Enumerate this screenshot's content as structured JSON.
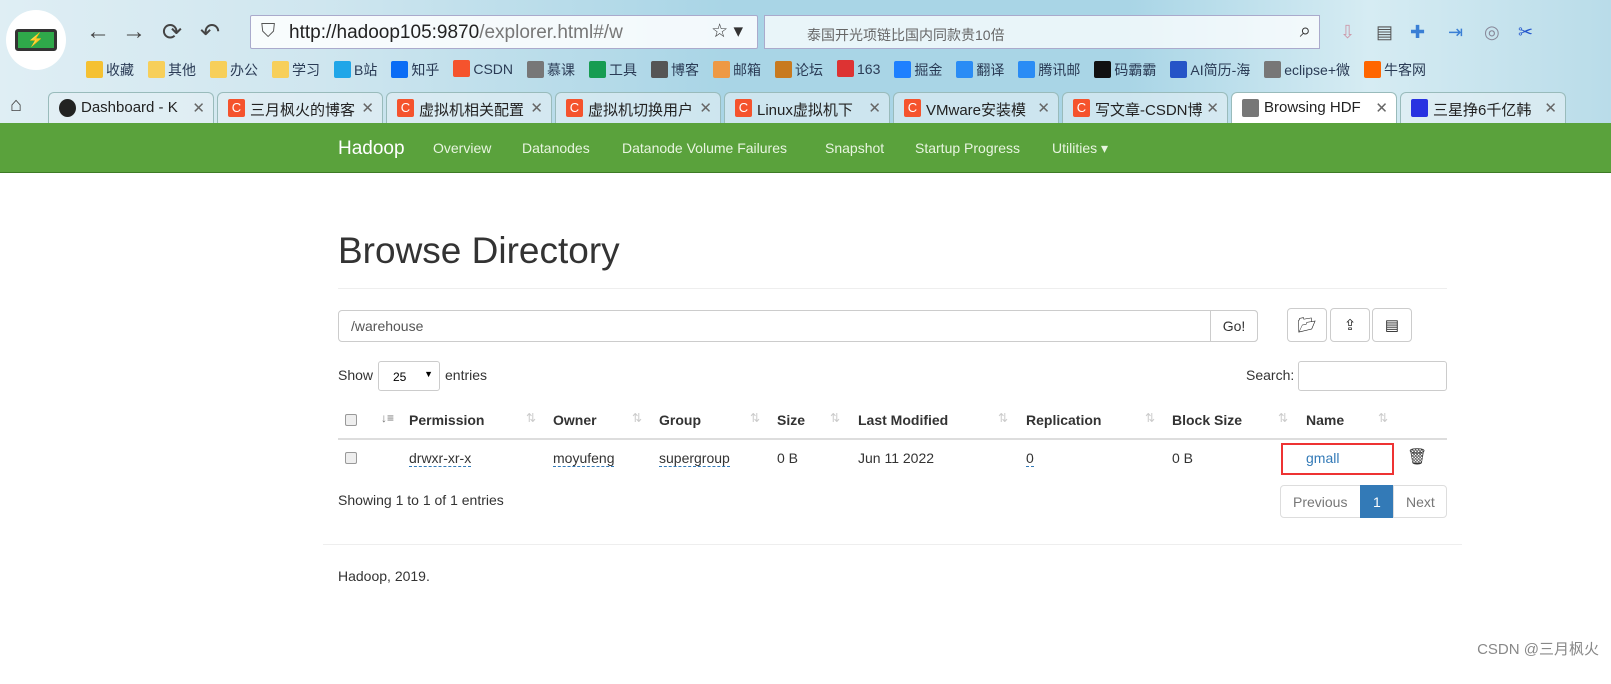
{
  "browser": {
    "url_host": "http://hadoop105:9870",
    "url_path": "/explorer.html#/w",
    "search_placeholder": "泰国开光项链比国内同款贵10倍",
    "bookmarks": [
      {
        "label": "收藏",
        "color": "#f5c132"
      },
      {
        "label": "其他",
        "color": "#f7cf5a"
      },
      {
        "label": "办公",
        "color": "#f7cf5a"
      },
      {
        "label": "学习",
        "color": "#f7cf5a"
      },
      {
        "label": "B站",
        "color": "#20a6e8"
      },
      {
        "label": "知乎",
        "color": "#0a6cf5"
      },
      {
        "label": "CSDN",
        "color": "#f5532d"
      },
      {
        "label": "慕课",
        "color": "#777"
      },
      {
        "label": "工具",
        "color": "#179c52"
      },
      {
        "label": "博客",
        "color": "#555"
      },
      {
        "label": "邮箱",
        "color": "#e94"
      },
      {
        "label": "论坛",
        "color": "#c87a1f"
      },
      {
        "label": "163",
        "color": "#d33"
      },
      {
        "label": "掘金",
        "color": "#1e80ff"
      },
      {
        "label": "翻译",
        "color": "#2a8cf5"
      },
      {
        "label": "腾讯邮",
        "color": "#2a8cf5"
      },
      {
        "label": "码霸霸",
        "color": "#111"
      },
      {
        "label": "AI简历-海",
        "color": "#2554c7"
      },
      {
        "label": "eclipse+微",
        "color": "#777"
      },
      {
        "label": "牛客网",
        "color": "#f60"
      }
    ],
    "tabs": [
      {
        "label": "Dashboard - K",
        "icon": "feather"
      },
      {
        "label": "三月枫火的博客",
        "icon": "C"
      },
      {
        "label": "虚拟机相关配置",
        "icon": "C"
      },
      {
        "label": "虚拟机切换用户",
        "icon": "C"
      },
      {
        "label": "Linux虚拟机下",
        "icon": "C"
      },
      {
        "label": "VMware安装模",
        "icon": "C"
      },
      {
        "label": "写文章-CSDN博",
        "icon": "C"
      },
      {
        "label": "Browsing HDF",
        "icon": "doc",
        "active": true
      },
      {
        "label": "三星挣6千亿韩",
        "icon": "baidu"
      }
    ]
  },
  "navbar": {
    "brand": "Hadoop",
    "items": [
      "Overview",
      "Datanodes",
      "Datanode Volume Failures",
      "Snapshot",
      "Startup Progress",
      "Utilities ▾"
    ],
    "color": "#5aa23c"
  },
  "page": {
    "title": "Browse Directory",
    "path": "/warehouse",
    "go": "Go!",
    "show": "Show",
    "entries_value": "25",
    "entries": "entries",
    "search_label": "Search:"
  },
  "table": {
    "headers": [
      "Permission",
      "Owner",
      "Group",
      "Size",
      "Last Modified",
      "Replication",
      "Block Size",
      "Name"
    ],
    "rows": [
      {
        "permission": "drwxr-xr-x",
        "owner": "moyufeng",
        "group": "supergroup",
        "size": "0 B",
        "modified": "Jun 11 2022",
        "replication": "0",
        "block_size": "0 B",
        "name": "gmall"
      }
    ]
  },
  "info": "Showing 1 to 1 of 1 entries",
  "pagination": {
    "prev": "Previous",
    "current": "1",
    "next": "Next"
  },
  "footer": "Hadoop, 2019.",
  "watermark": "CSDN @三月枫火"
}
